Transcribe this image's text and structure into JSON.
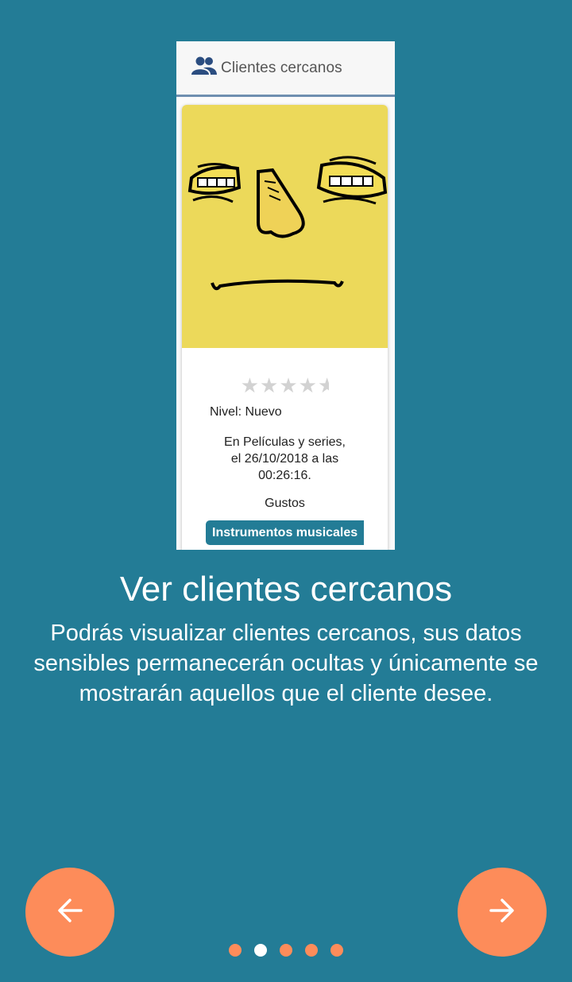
{
  "screenshot": {
    "header_title": "Clientes cercanos",
    "header_icon": "people-icon",
    "rating_stars": 4.5,
    "level": "Nivel: Nuevo",
    "date_lines": [
      "En Películas y series,",
      "el 26/10/2018 a las",
      "00:26:16."
    ],
    "gustos_label": "Gustos",
    "tag": "Instrumentos musicales"
  },
  "title": "Ver clientes cercanos",
  "description_lines": [
    "Podrás visualizar clientes cercanos, sus datos",
    "sensibles permanecerán ocultas y únicamente se",
    "mostrarán aquellos que el cliente desee."
  ],
  "navigation": {
    "prev_icon": "arrow-left-icon",
    "next_icon": "arrow-right-icon",
    "page_count": 5,
    "current_page": 2
  },
  "colors": {
    "background": "#237c96",
    "accent": "#fd8c5a",
    "avatar_bg": "#ecd95a",
    "dot_active": "#ffffff"
  }
}
